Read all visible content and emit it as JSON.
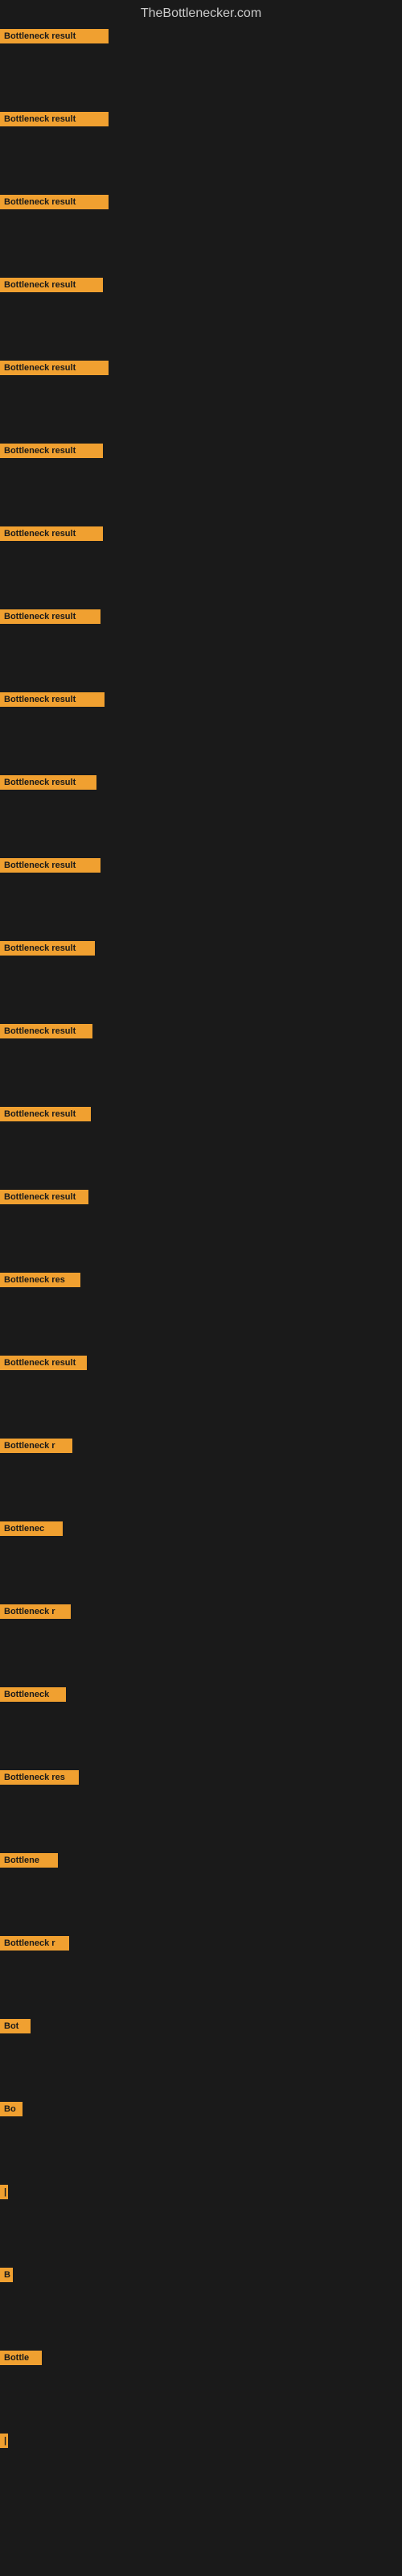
{
  "site_title": "TheBottlenecker.com",
  "bars": [
    {
      "label": "Bottleneck result",
      "width": 135
    },
    {
      "label": "Bottleneck result",
      "width": 135
    },
    {
      "label": "Bottleneck result",
      "width": 135
    },
    {
      "label": "Bottleneck result",
      "width": 128
    },
    {
      "label": "Bottleneck result",
      "width": 135
    },
    {
      "label": "Bottleneck result",
      "width": 128
    },
    {
      "label": "Bottleneck result",
      "width": 128
    },
    {
      "label": "Bottleneck result",
      "width": 125
    },
    {
      "label": "Bottleneck result",
      "width": 130
    },
    {
      "label": "Bottleneck result",
      "width": 120
    },
    {
      "label": "Bottleneck result",
      "width": 125
    },
    {
      "label": "Bottleneck result",
      "width": 118
    },
    {
      "label": "Bottleneck result",
      "width": 115
    },
    {
      "label": "Bottleneck result",
      "width": 113
    },
    {
      "label": "Bottleneck result",
      "width": 110
    },
    {
      "label": "Bottleneck res",
      "width": 100
    },
    {
      "label": "Bottleneck result",
      "width": 108
    },
    {
      "label": "Bottleneck r",
      "width": 90
    },
    {
      "label": "Bottlenec",
      "width": 78
    },
    {
      "label": "Bottleneck r",
      "width": 88
    },
    {
      "label": "Bottleneck",
      "width": 82
    },
    {
      "label": "Bottleneck res",
      "width": 98
    },
    {
      "label": "Bottlene",
      "width": 72
    },
    {
      "label": "Bottleneck r",
      "width": 86
    },
    {
      "label": "Bot",
      "width": 38
    },
    {
      "label": "Bo",
      "width": 28
    },
    {
      "label": "|",
      "width": 8
    },
    {
      "label": "B",
      "width": 16
    },
    {
      "label": "Bottle",
      "width": 52
    },
    {
      "label": "|",
      "width": 8
    }
  ]
}
